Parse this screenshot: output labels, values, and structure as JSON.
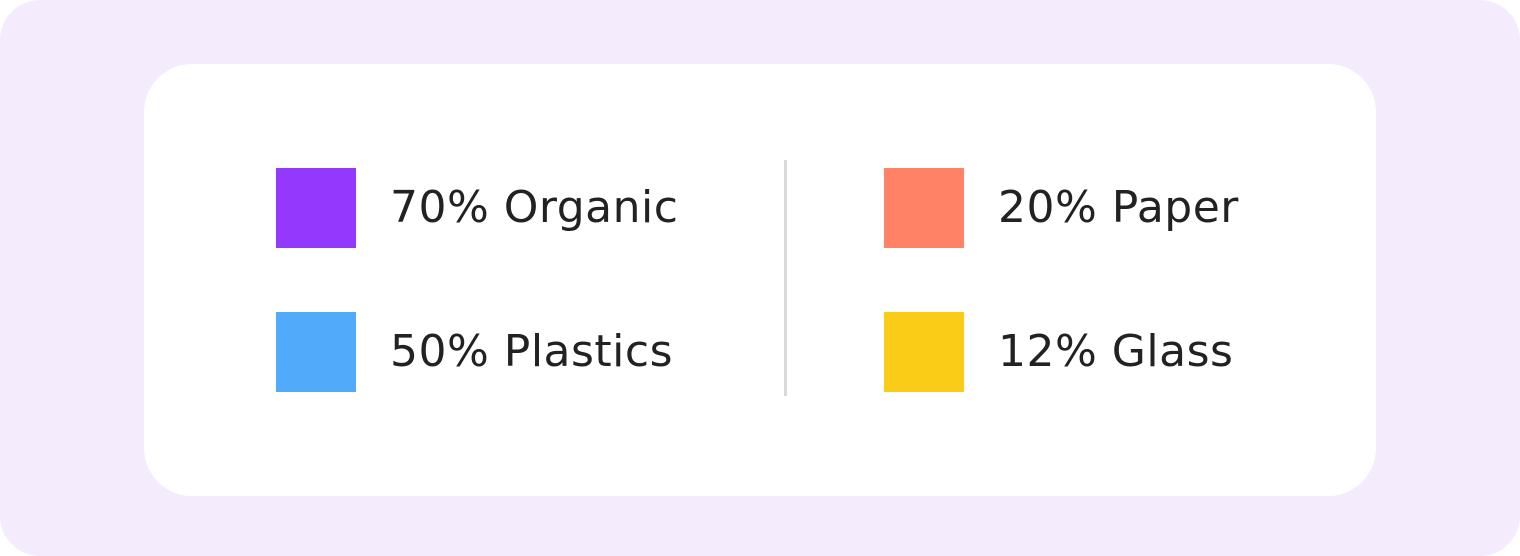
{
  "colors": {
    "frame_background": "#f4ebfd",
    "card_background": "#ffffff"
  },
  "chart_data": {
    "type": "legend",
    "items": [
      {
        "label": "70% Organic",
        "percent": 70,
        "category": "Organic",
        "color": "#9438fd"
      },
      {
        "label": "20% Paper",
        "percent": 20,
        "category": "Paper",
        "color": "#ff8166"
      },
      {
        "label": "50% Plastics",
        "percent": 50,
        "category": "Plastics",
        "color": "#52aafb"
      },
      {
        "label": "12% Glass",
        "percent": 12,
        "category": "Glass",
        "color": "#facc17"
      }
    ]
  }
}
